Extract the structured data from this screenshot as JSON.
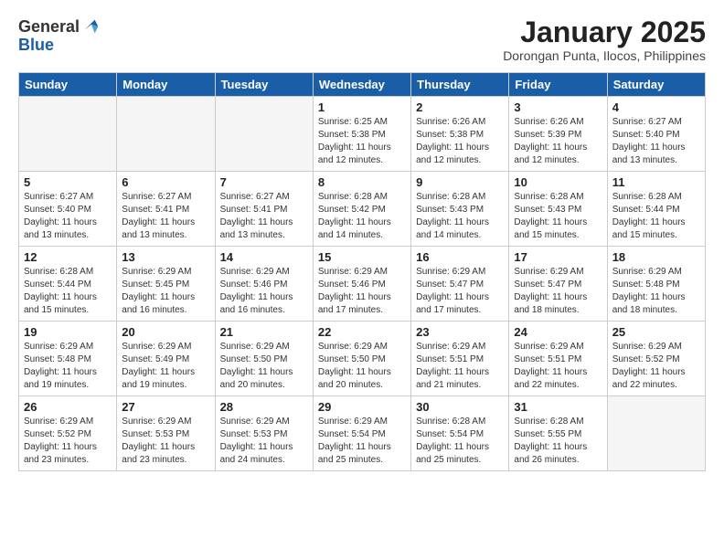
{
  "header": {
    "logo_general": "General",
    "logo_blue": "Blue",
    "title": "January 2025",
    "location": "Dorongan Punta, Ilocos, Philippines"
  },
  "weekdays": [
    "Sunday",
    "Monday",
    "Tuesday",
    "Wednesday",
    "Thursday",
    "Friday",
    "Saturday"
  ],
  "weeks": [
    [
      {
        "day": "",
        "empty": true
      },
      {
        "day": "",
        "empty": true
      },
      {
        "day": "",
        "empty": true
      },
      {
        "day": "1",
        "sunrise": "6:25 AM",
        "sunset": "5:38 PM",
        "daylight": "11 hours and 12 minutes."
      },
      {
        "day": "2",
        "sunrise": "6:26 AM",
        "sunset": "5:38 PM",
        "daylight": "11 hours and 12 minutes."
      },
      {
        "day": "3",
        "sunrise": "6:26 AM",
        "sunset": "5:39 PM",
        "daylight": "11 hours and 12 minutes."
      },
      {
        "day": "4",
        "sunrise": "6:27 AM",
        "sunset": "5:40 PM",
        "daylight": "11 hours and 13 minutes."
      }
    ],
    [
      {
        "day": "5",
        "sunrise": "6:27 AM",
        "sunset": "5:40 PM",
        "daylight": "11 hours and 13 minutes."
      },
      {
        "day": "6",
        "sunrise": "6:27 AM",
        "sunset": "5:41 PM",
        "daylight": "11 hours and 13 minutes."
      },
      {
        "day": "7",
        "sunrise": "6:27 AM",
        "sunset": "5:41 PM",
        "daylight": "11 hours and 13 minutes."
      },
      {
        "day": "8",
        "sunrise": "6:28 AM",
        "sunset": "5:42 PM",
        "daylight": "11 hours and 14 minutes."
      },
      {
        "day": "9",
        "sunrise": "6:28 AM",
        "sunset": "5:43 PM",
        "daylight": "11 hours and 14 minutes."
      },
      {
        "day": "10",
        "sunrise": "6:28 AM",
        "sunset": "5:43 PM",
        "daylight": "11 hours and 15 minutes."
      },
      {
        "day": "11",
        "sunrise": "6:28 AM",
        "sunset": "5:44 PM",
        "daylight": "11 hours and 15 minutes."
      }
    ],
    [
      {
        "day": "12",
        "sunrise": "6:28 AM",
        "sunset": "5:44 PM",
        "daylight": "11 hours and 15 minutes."
      },
      {
        "day": "13",
        "sunrise": "6:29 AM",
        "sunset": "5:45 PM",
        "daylight": "11 hours and 16 minutes."
      },
      {
        "day": "14",
        "sunrise": "6:29 AM",
        "sunset": "5:46 PM",
        "daylight": "11 hours and 16 minutes."
      },
      {
        "day": "15",
        "sunrise": "6:29 AM",
        "sunset": "5:46 PM",
        "daylight": "11 hours and 17 minutes."
      },
      {
        "day": "16",
        "sunrise": "6:29 AM",
        "sunset": "5:47 PM",
        "daylight": "11 hours and 17 minutes."
      },
      {
        "day": "17",
        "sunrise": "6:29 AM",
        "sunset": "5:47 PM",
        "daylight": "11 hours and 18 minutes."
      },
      {
        "day": "18",
        "sunrise": "6:29 AM",
        "sunset": "5:48 PM",
        "daylight": "11 hours and 18 minutes."
      }
    ],
    [
      {
        "day": "19",
        "sunrise": "6:29 AM",
        "sunset": "5:48 PM",
        "daylight": "11 hours and 19 minutes."
      },
      {
        "day": "20",
        "sunrise": "6:29 AM",
        "sunset": "5:49 PM",
        "daylight": "11 hours and 19 minutes."
      },
      {
        "day": "21",
        "sunrise": "6:29 AM",
        "sunset": "5:50 PM",
        "daylight": "11 hours and 20 minutes."
      },
      {
        "day": "22",
        "sunrise": "6:29 AM",
        "sunset": "5:50 PM",
        "daylight": "11 hours and 20 minutes."
      },
      {
        "day": "23",
        "sunrise": "6:29 AM",
        "sunset": "5:51 PM",
        "daylight": "11 hours and 21 minutes."
      },
      {
        "day": "24",
        "sunrise": "6:29 AM",
        "sunset": "5:51 PM",
        "daylight": "11 hours and 22 minutes."
      },
      {
        "day": "25",
        "sunrise": "6:29 AM",
        "sunset": "5:52 PM",
        "daylight": "11 hours and 22 minutes."
      }
    ],
    [
      {
        "day": "26",
        "sunrise": "6:29 AM",
        "sunset": "5:52 PM",
        "daylight": "11 hours and 23 minutes."
      },
      {
        "day": "27",
        "sunrise": "6:29 AM",
        "sunset": "5:53 PM",
        "daylight": "11 hours and 23 minutes."
      },
      {
        "day": "28",
        "sunrise": "6:29 AM",
        "sunset": "5:53 PM",
        "daylight": "11 hours and 24 minutes."
      },
      {
        "day": "29",
        "sunrise": "6:29 AM",
        "sunset": "5:54 PM",
        "daylight": "11 hours and 25 minutes."
      },
      {
        "day": "30",
        "sunrise": "6:28 AM",
        "sunset": "5:54 PM",
        "daylight": "11 hours and 25 minutes."
      },
      {
        "day": "31",
        "sunrise": "6:28 AM",
        "sunset": "5:55 PM",
        "daylight": "11 hours and 26 minutes."
      },
      {
        "day": "",
        "empty": true
      }
    ]
  ],
  "labels": {
    "sunrise": "Sunrise:",
    "sunset": "Sunset:",
    "daylight": "Daylight:"
  }
}
